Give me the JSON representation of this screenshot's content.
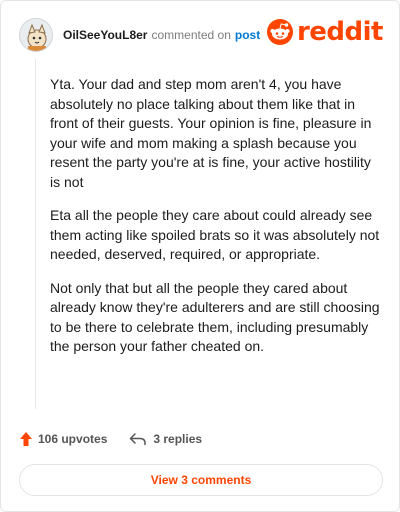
{
  "header": {
    "username": "OilSeeYouL8er",
    "commented_text": "commented on",
    "post_link": "post",
    "logo_text": "reddit"
  },
  "comment": {
    "paragraphs": [
      "Yta. Your dad and step mom aren't 4, you have absolutely no place talking about them like that in front of their guests. Your opinion is fine, pleasure in your wife and mom making a splash because you resent the party you're at is fine, your active hostility is not",
      "Eta all the people they care about could already see them acting like spoiled brats so it was absolutely not needed, deserved, required, or appropriate.",
      "Not only that but all the people they cared about already know they're adulterers and are still choosing to be there to celebrate them, including presumably the person your father cheated on."
    ]
  },
  "actions": {
    "upvotes": "106 upvotes",
    "replies": "3 replies"
  },
  "footer": {
    "view_comments": "View 3 comments"
  },
  "colors": {
    "brand": "#ff4500",
    "link": "#0079d3"
  },
  "icons": {
    "upvote": "upvote-arrow-icon",
    "reply": "reply-arrow-icon",
    "logo": "reddit-snoo-icon"
  }
}
